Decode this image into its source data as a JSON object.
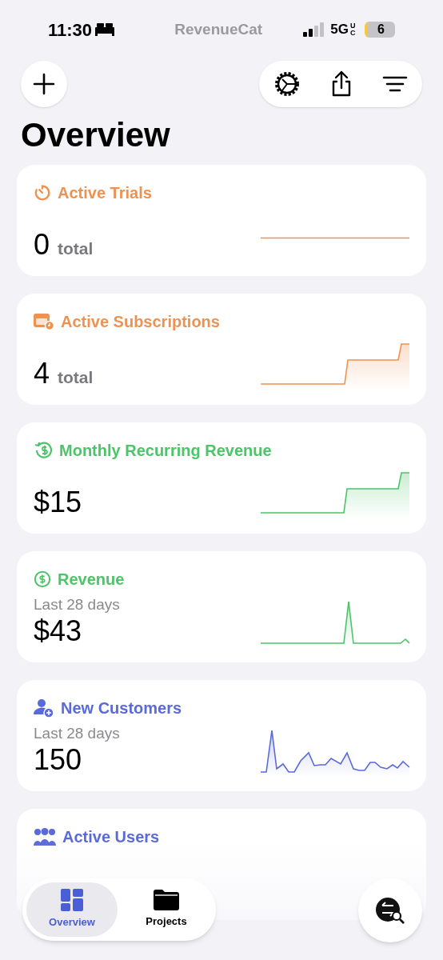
{
  "status_bar": {
    "time": "11:30",
    "app_logo": "RevenueCat",
    "network": "5G",
    "network_sub": "UC",
    "battery": "6"
  },
  "header": {
    "title": "Overview"
  },
  "cards": [
    {
      "title": "Active Trials",
      "color": "#ee9252",
      "value": "0",
      "unit": "total"
    },
    {
      "title": "Active Subscriptions",
      "color": "#ee9252",
      "value": "4",
      "unit": "total"
    },
    {
      "title": "Monthly Recurring Revenue",
      "color": "#4ec46a",
      "value": "$15"
    },
    {
      "title": "Revenue",
      "color": "#4ec46a",
      "subtitle": "Last 28 days",
      "value": "$43"
    },
    {
      "title": "New Customers",
      "color": "#5a6ad8",
      "subtitle": "Last 28 days",
      "value": "150"
    },
    {
      "title": "Active Users",
      "color": "#5a6ad8"
    }
  ],
  "tab_bar": {
    "tabs": [
      {
        "label": "Overview",
        "selected": true
      },
      {
        "label": "Projects",
        "selected": false
      }
    ]
  }
}
